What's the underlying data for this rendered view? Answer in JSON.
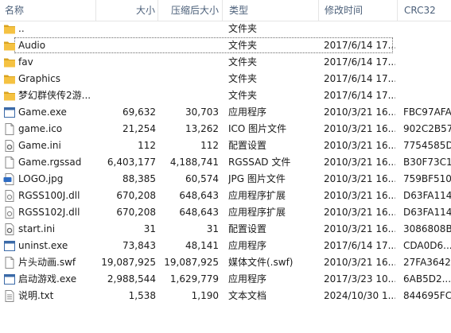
{
  "header": {
    "name": "名称",
    "size": "大小",
    "packed": "压缩后大小",
    "type": "类型",
    "modified": "修改时间",
    "crc": "CRC32"
  },
  "colors": {
    "folder": "#f5c242",
    "folder_dark": "#d9a31f",
    "header_text": "#4c607a",
    "text": "#1a1a1a"
  },
  "rows": [
    {
      "icon": "folder-icon",
      "name": "..",
      "size": "",
      "packed": "",
      "type": "文件夹",
      "modified": "",
      "crc": ""
    },
    {
      "icon": "folder-icon",
      "name": "Audio",
      "size": "",
      "packed": "",
      "type": "文件夹",
      "modified": "2017/6/14 17...",
      "crc": ""
    },
    {
      "icon": "folder-icon",
      "name": "fav",
      "size": "",
      "packed": "",
      "type": "文件夹",
      "modified": "2017/6/14 17...",
      "crc": ""
    },
    {
      "icon": "folder-icon",
      "name": "Graphics",
      "size": "",
      "packed": "",
      "type": "文件夹",
      "modified": "2017/6/14 17...",
      "crc": ""
    },
    {
      "icon": "folder-icon",
      "name": "梦幻群侠传2游...",
      "size": "",
      "packed": "",
      "type": "文件夹",
      "modified": "2017/6/14 17...",
      "crc": ""
    },
    {
      "icon": "exe-icon",
      "name": "Game.exe",
      "size": "69,632",
      "packed": "30,703",
      "type": "应用程序",
      "modified": "2010/3/21 16...",
      "crc": "FBC97AFA"
    },
    {
      "icon": "file-icon",
      "name": "game.ico",
      "size": "21,254",
      "packed": "13,262",
      "type": "ICO 图片文件",
      "modified": "2010/3/21 16...",
      "crc": "902C2B57"
    },
    {
      "icon": "settings-file-icon",
      "name": "Game.ini",
      "size": "112",
      "packed": "112",
      "type": "配置设置",
      "modified": "2010/3/21 16...",
      "crc": "7754585D"
    },
    {
      "icon": "file-icon",
      "name": "Game.rgssad",
      "size": "6,403,177",
      "packed": "4,188,741",
      "type": "RGSSAD 文件",
      "modified": "2010/3/21 16...",
      "crc": "B30F73C1"
    },
    {
      "icon": "jpg-icon",
      "name": "LOGO.jpg",
      "size": "88,385",
      "packed": "60,574",
      "type": "JPG 图片文件",
      "modified": "2010/3/21 16...",
      "crc": "759BF510"
    },
    {
      "icon": "dll-icon",
      "name": "RGSS100J.dll",
      "size": "670,208",
      "packed": "648,643",
      "type": "应用程序扩展",
      "modified": "2010/3/21 16...",
      "crc": "D63FA114"
    },
    {
      "icon": "dll-icon",
      "name": "RGSS102J.dll",
      "size": "670,208",
      "packed": "648,643",
      "type": "应用程序扩展",
      "modified": "2010/3/21 16...",
      "crc": "D63FA114"
    },
    {
      "icon": "settings-file-icon",
      "name": "start.ini",
      "size": "31",
      "packed": "31",
      "type": "配置设置",
      "modified": "2010/3/21 16...",
      "crc": "3086808B"
    },
    {
      "icon": "exe-icon",
      "name": "uninst.exe",
      "size": "73,843",
      "packed": "48,141",
      "type": "应用程序",
      "modified": "2017/6/14 17...",
      "crc": "CDA0D6..."
    },
    {
      "icon": "file-icon",
      "name": "片头动画.swf",
      "size": "19,087,925",
      "packed": "19,087,925",
      "type": "媒体文件(.swf)",
      "modified": "2010/3/21 16...",
      "crc": "27FA3642"
    },
    {
      "icon": "exe-icon",
      "name": "启动游戏.exe",
      "size": "2,988,544",
      "packed": "1,629,779",
      "type": "应用程序",
      "modified": "2017/3/23 10...",
      "crc": "6AB5D2..."
    },
    {
      "icon": "text-file-icon",
      "name": "说明.txt",
      "size": "1,538",
      "packed": "1,190",
      "type": "文本文档",
      "modified": "2024/10/30 1...",
      "crc": "844695FC"
    }
  ],
  "focused_row": 1
}
